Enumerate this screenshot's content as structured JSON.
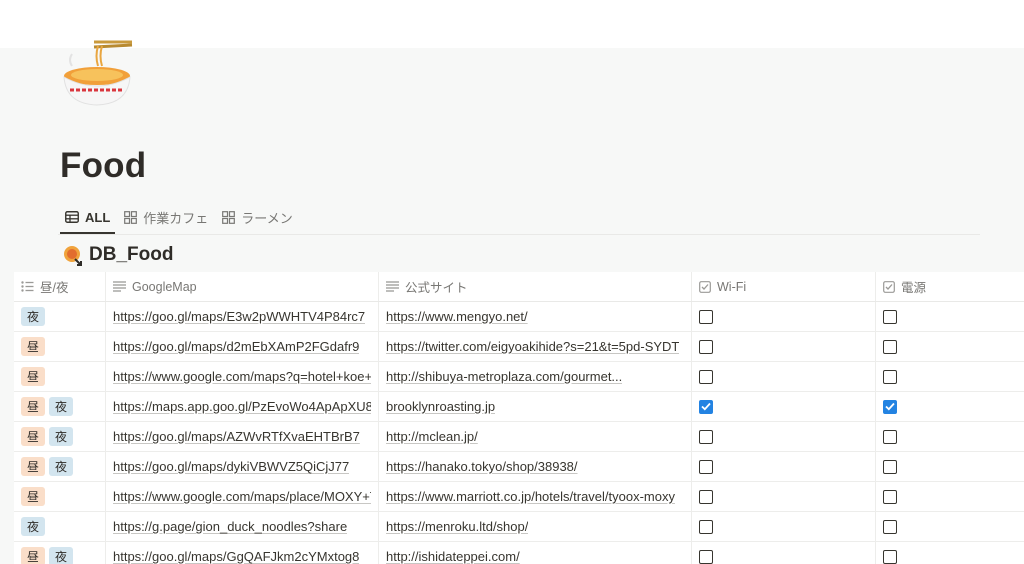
{
  "page": {
    "title": "Food",
    "icon": "ramen-bowl-icon"
  },
  "views": [
    {
      "label": "ALL",
      "icon": "table-icon",
      "active": true
    },
    {
      "label": "作業カフェ",
      "icon": "gallery-icon",
      "active": false
    },
    {
      "label": "ラーメン",
      "icon": "gallery-icon",
      "active": false
    }
  ],
  "database": {
    "title": "DB_Food",
    "icon": "linked-database-icon"
  },
  "columns": {
    "time": {
      "label": "昼/夜",
      "icon": "multi-select-icon"
    },
    "map": {
      "label": "GoogleMap",
      "icon": "text-icon"
    },
    "site": {
      "label": "公式サイト",
      "icon": "text-icon"
    },
    "wifi": {
      "label": "Wi-Fi",
      "icon": "checkbox-icon"
    },
    "power": {
      "label": "電源",
      "icon": "checkbox-icon"
    }
  },
  "tag_colors": {
    "昼": "#fadec9",
    "夜": "#d3e5ef"
  },
  "rows": [
    {
      "tags": [
        "夜"
      ],
      "map": "https://goo.gl/maps/E3w2pWWHTV4P84rc7",
      "site": "https://www.mengyo.net/",
      "wifi": false,
      "power": false
    },
    {
      "tags": [
        "昼"
      ],
      "map": "https://goo.gl/maps/d2mEbXAmP2FGdafr9",
      "site": "https://twitter.com/eigyoakihide?s=21&t=5pd-SYDT",
      "wifi": false,
      "power": false
    },
    {
      "tags": [
        "昼"
      ],
      "map": "https://www.google.com/maps?q=hotel+koe+",
      "site": "http://shibuya-metroplaza.com/gourmet...",
      "wifi": false,
      "power": false
    },
    {
      "tags": [
        "昼",
        "夜"
      ],
      "map": "https://maps.app.goo.gl/PzEvoWo4ApApXU8",
      "site": "brooklynroasting.jp",
      "wifi": true,
      "power": true
    },
    {
      "tags": [
        "昼",
        "夜"
      ],
      "map": "https://goo.gl/maps/AZWvRTfXvaEHTBrB7",
      "site": "http://mclean.jp/",
      "wifi": false,
      "power": false
    },
    {
      "tags": [
        "昼",
        "夜"
      ],
      "map": "https://goo.gl/maps/dykiVBWVZ5QiCjJ77",
      "site": "https://hanako.tokyo/shop/38938/",
      "wifi": false,
      "power": false
    },
    {
      "tags": [
        "昼"
      ],
      "map": "https://www.google.com/maps/place/MOXY+T",
      "site": "https://www.marriott.co.jp/hotels/travel/tyoox-moxy",
      "wifi": false,
      "power": false
    },
    {
      "tags": [
        "夜"
      ],
      "map": "https://g.page/gion_duck_noodles?share",
      "site": "https://menroku.ltd/shop/",
      "wifi": false,
      "power": false
    },
    {
      "tags": [
        "昼",
        "夜"
      ],
      "map": "https://goo.gl/maps/GgQAFJkm2cYMxtog8",
      "site": "http://ishidateppei.com/",
      "wifi": false,
      "power": false
    }
  ]
}
